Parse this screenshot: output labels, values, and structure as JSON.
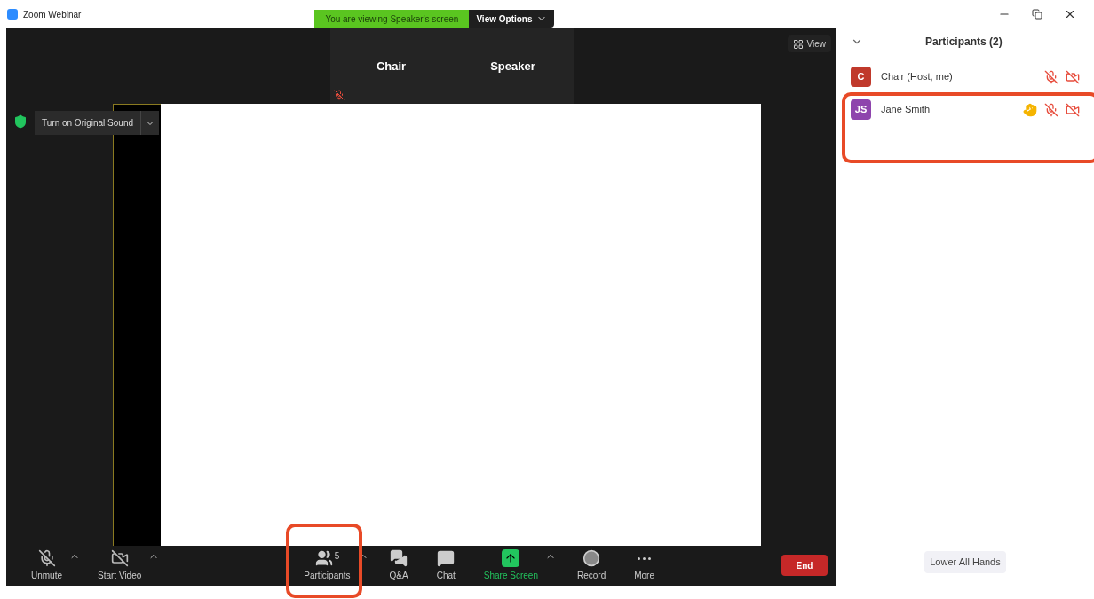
{
  "window": {
    "title": "Zoom Webinar"
  },
  "banner": {
    "text": "You are viewing Speaker's screen",
    "view_options": "View Options"
  },
  "thumbnails": [
    {
      "name": "Chair",
      "muted": true
    },
    {
      "name": "Speaker",
      "muted": false
    }
  ],
  "view_button": "View",
  "original_sound_button": "Turn on Original Sound",
  "toolbar": [
    {
      "kind": "mic",
      "label": "Unmute",
      "has_menu": true,
      "highlighted": false
    },
    {
      "kind": "video",
      "label": "Start Video",
      "has_menu": true,
      "highlighted": false
    },
    {
      "kind": "participants",
      "label": "Participants",
      "count": "5",
      "has_menu": true,
      "highlighted": true
    },
    {
      "kind": "qa",
      "label": "Q&A",
      "has_menu": false,
      "highlighted": false
    },
    {
      "kind": "chat",
      "label": "Chat",
      "has_menu": false,
      "highlighted": false
    },
    {
      "kind": "share",
      "label": "Share Screen",
      "has_menu": true,
      "highlighted": false
    },
    {
      "kind": "record",
      "label": "Record",
      "has_menu": false,
      "highlighted": false
    },
    {
      "kind": "more",
      "label": "More",
      "has_menu": false,
      "highlighted": false
    }
  ],
  "end_button": "End",
  "panel": {
    "title": "Participants (2)",
    "lower_all_hands": "Lower All Hands",
    "participants": [
      {
        "initials": "C",
        "name": "Chair (Host, me)",
        "color": "#c0392b",
        "hand_raised": false,
        "mic_muted": true,
        "video_off": true,
        "highlighted": false
      },
      {
        "initials": "JS",
        "name": "Jane Smith",
        "color": "#8e44ad",
        "hand_raised": true,
        "mic_muted": true,
        "video_off": true,
        "highlighted": true
      }
    ]
  }
}
